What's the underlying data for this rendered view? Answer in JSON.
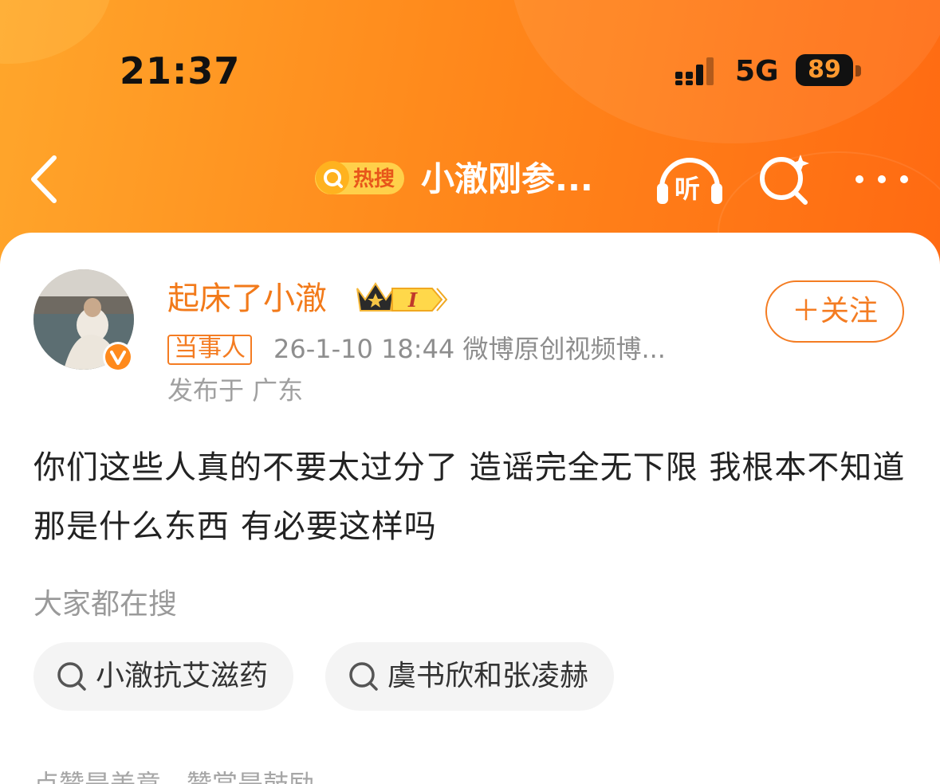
{
  "colors": {
    "header_gradient_start": "#ffa62b",
    "header_gradient_end": "#ff6a12",
    "accent_orange": "#f47c22",
    "username_orange": "#f27a1a",
    "battery_digits": "#ff9a30"
  },
  "status_bar": {
    "time": "21:37",
    "network": "5G",
    "battery": "89",
    "icons": [
      "signal-icon",
      "battery-icon"
    ]
  },
  "nav": {
    "back_icon": "chevron-left-icon",
    "hot_search_label": "热搜",
    "title": "小澈刚参...",
    "listen_label": "听",
    "listen_icon": "headphones-icon",
    "search_icon": "ai-search-icon",
    "more_icon": "more-dots-icon"
  },
  "post": {
    "username": "起床了小澈",
    "crown_icon": "crown-icon",
    "level": "I",
    "follow_label": "＋关注",
    "involved_tag": "当事人",
    "meta": "26-1-10 18:44  微博原创视频博...",
    "location": "发布于 广东",
    "content": "你们这些人真的不要太过分了 造谣完全无下限 我根本不知道那是什么东西 有必要这样吗"
  },
  "trending": {
    "label": "大家都在搜",
    "chips": [
      {
        "label": "小澈抗艾滋药",
        "icon": "search-icon"
      },
      {
        "label": "虞书欣和张凌赫",
        "icon": "search-icon"
      }
    ]
  },
  "footer": {
    "note": "点赞是美意，赞赏是鼓励"
  }
}
